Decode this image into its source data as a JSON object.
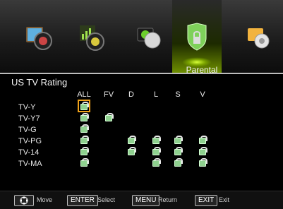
{
  "nav": {
    "items": [
      {
        "id": "picture",
        "icon": "picture-icon"
      },
      {
        "id": "sound",
        "icon": "sound-icon"
      },
      {
        "id": "channel",
        "icon": "channel-icon"
      },
      {
        "id": "parental",
        "icon": "parental-lock-icon",
        "active": true
      },
      {
        "id": "setup",
        "icon": "setup-gear-icon"
      }
    ],
    "active_label": "Parental"
  },
  "menu": {
    "title": "US TV Rating",
    "columns": [
      "ALL",
      "FV",
      "D",
      "L",
      "S",
      "V"
    ],
    "rows": [
      "TV-Y",
      "TV-Y7",
      "TV-G",
      "TV-PG",
      "TV-14",
      "TV-MA"
    ]
  },
  "footer": {
    "move_label": "Move",
    "enter_key": "ENTER",
    "enter_label": "Select",
    "menu_key": "MENU",
    "menu_label": "Return",
    "exit_key": "EXIT",
    "exit_label": "Exit"
  }
}
